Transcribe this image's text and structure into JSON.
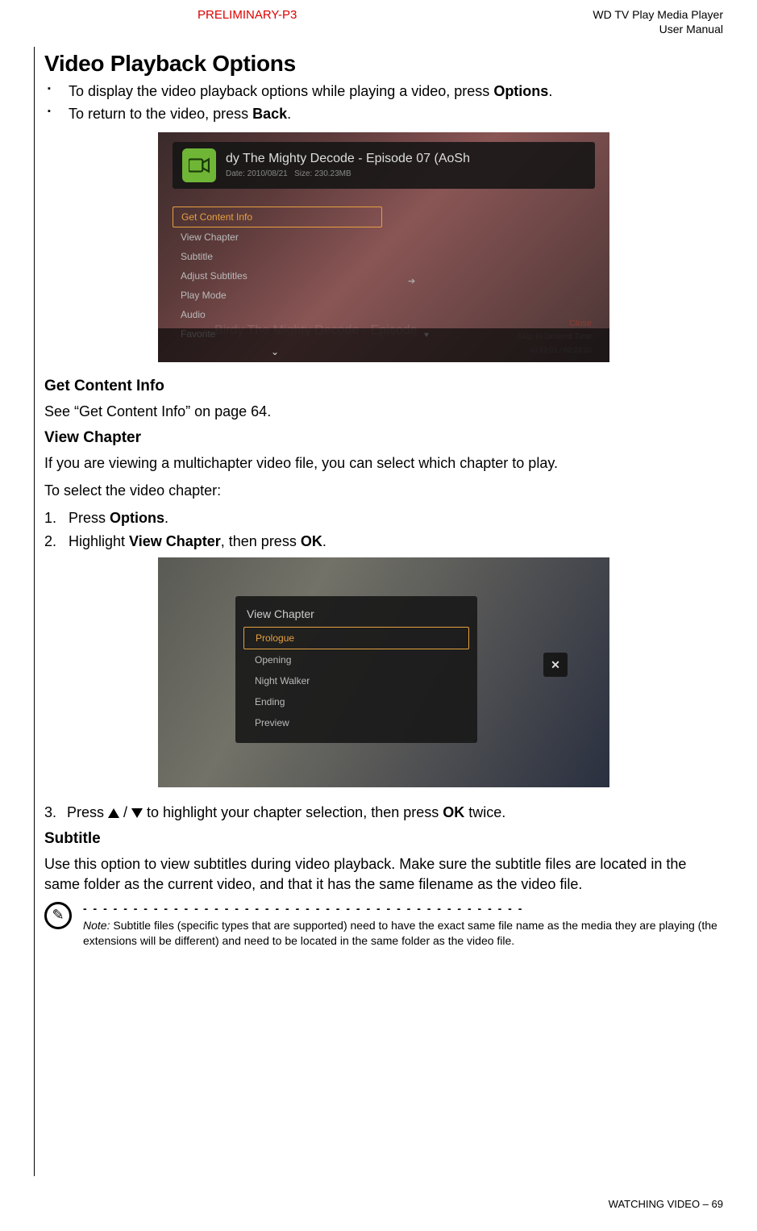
{
  "header": {
    "preliminary": "PRELIMINARY-P3",
    "product_line1": "WD TV Play Media Player",
    "product_line2": "User Manual"
  },
  "title": "Video Playback Options",
  "intro_bullets": [
    {
      "pre": "To display the video playback options while playing a video, press ",
      "bold": "Options",
      "post": "."
    },
    {
      "pre": "To return to the video, press ",
      "bold": "Back",
      "post": "."
    }
  ],
  "shot1": {
    "title": "dy The Mighty Decode - Episode 07 (AoSh",
    "date_label": "Date: 2010/08/21",
    "size_label": "Size: 230.23MB",
    "menu": [
      "Get Content Info",
      "View Chapter",
      "Subtitle",
      "Adjust Subtitles",
      "Play Mode",
      "Audio",
      "Favorite"
    ],
    "ghost": "Birdy The Mighty Decode - Episode",
    "close": "Close",
    "skip": "Skip to Desired Time",
    "time": "00:19:01 / 02:24:10"
  },
  "sec_get_content": {
    "heading": "Get Content Info",
    "text": "See “Get Content Info” on page 64."
  },
  "sec_view_chapter": {
    "heading": "View Chapter",
    "p1": "If you are viewing a multichapter video file, you can select which chapter to play.",
    "p2": "To select the video chapter:",
    "steps": {
      "s1": {
        "pre": "Press ",
        "bold": "Options",
        "post": "."
      },
      "s2": {
        "pre": "Highlight ",
        "bold": "View Chapter",
        "mid": ", then press ",
        "bold2": "OK",
        "post": "."
      }
    }
  },
  "shot2": {
    "panel_title": "View Chapter",
    "items": [
      "Prologue",
      "Opening",
      "Night Walker",
      "Ending",
      "Preview"
    ],
    "close": "✕"
  },
  "step3": {
    "num": "3.",
    "pre": "Press ",
    "mid": " / ",
    "post_a": " to highlight your chapter selection, then press ",
    "bold": "OK",
    "post_b": " twice."
  },
  "sec_subtitle": {
    "heading": "Subtitle",
    "p": "Use this option to view subtitles during video playback. Make sure the subtitle files are located in the same folder as the current video, and that it has the same filename as the video file."
  },
  "note": {
    "dashes": "- - - - - - - - - - - - - - - - - - - - - - - - - - - - - - - - - - - - - - - - - - - -",
    "label": "Note:",
    "text": " Subtitle files (specific types that are supported) need to have the exact same file name as the media they are playing (the extensions will be different) and need to be located in the same folder as the video file."
  },
  "footer": {
    "section": "WATCHING VIDEO",
    "sep": " – ",
    "page": "69"
  }
}
